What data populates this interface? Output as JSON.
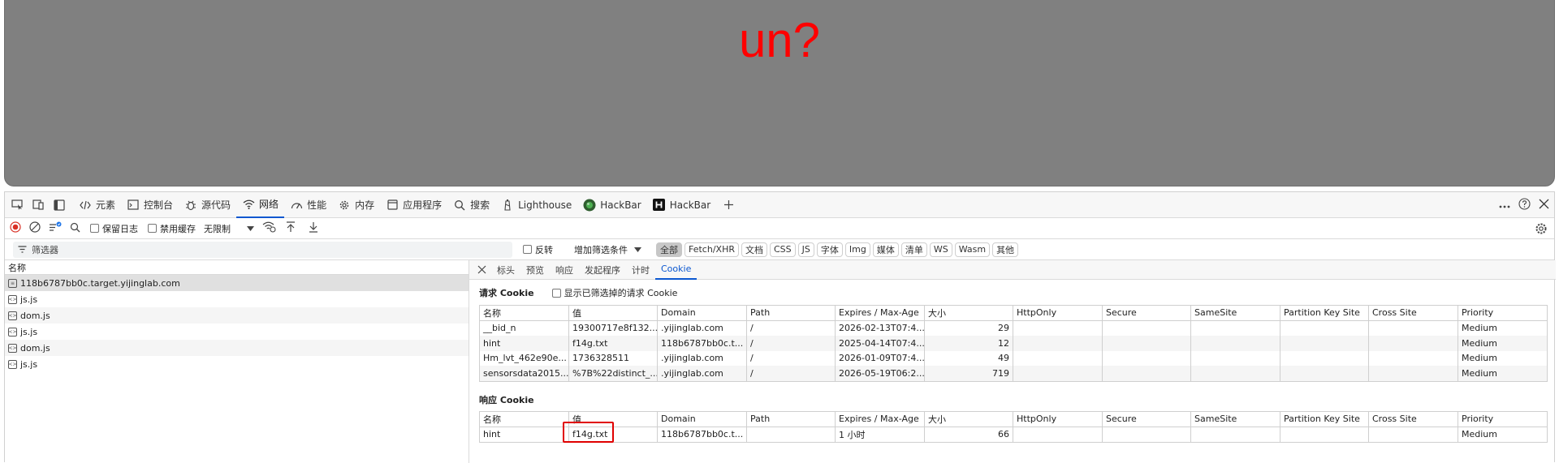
{
  "page": {
    "text": "un?"
  },
  "devtools": {
    "tabs": [
      {
        "label": "元素"
      },
      {
        "label": "控制台"
      },
      {
        "label": "源代码"
      },
      {
        "label": "网络"
      },
      {
        "label": "性能"
      },
      {
        "label": "内存"
      },
      {
        "label": "应用程序"
      },
      {
        "label": "搜索"
      },
      {
        "label": "Lighthouse"
      },
      {
        "label": "HackBar"
      },
      {
        "label": "HackBar"
      }
    ],
    "toolbar": {
      "preserve_log": "保留日志",
      "disable_cache": "禁用缓存",
      "throttling": "无限制"
    },
    "filter": {
      "placeholder": "筛选器",
      "invert": "反转",
      "more_filters": "增加筛选条件"
    },
    "types": [
      "全部",
      "Fetch/XHR",
      "文档",
      "CSS",
      "JS",
      "字体",
      "Img",
      "媒体",
      "清单",
      "WS",
      "Wasm",
      "其他"
    ],
    "requests": {
      "header": "名称",
      "items": [
        "118b6787bb0c.target.yijinglab.com",
        "js.js",
        "dom.js",
        "js.js",
        "dom.js",
        "js.js"
      ]
    },
    "detail_tabs": [
      "标头",
      "预览",
      "响应",
      "发起程序",
      "计时",
      "Cookie"
    ],
    "request_cookies": {
      "title": "请求 Cookie",
      "show_filtered": "显示已筛选掉的请求 Cookie",
      "columns": [
        "名称",
        "值",
        "Domain",
        "Path",
        "Expires / Max-Age",
        "大小",
        "HttpOnly",
        "Secure",
        "SameSite",
        "Partition Key Site",
        "Cross Site",
        "Priority"
      ],
      "rows": [
        [
          "__bid_n",
          "19300717e8f132...",
          ".yijinglab.com",
          "/",
          "2026-02-13T07:4...",
          "29",
          "",
          "",
          "",
          "",
          "",
          "Medium"
        ],
        [
          "hint",
          "f14g.txt",
          "118b6787bb0c.t...",
          "/",
          "2025-04-14T07:4...",
          "12",
          "",
          "",
          "",
          "",
          "",
          "Medium"
        ],
        [
          "Hm_lvt_462e90e...",
          "1736328511",
          ".yijinglab.com",
          "/",
          "2026-01-09T07:4...",
          "49",
          "",
          "",
          "",
          "",
          "",
          "Medium"
        ],
        [
          "sensorsdata2015...",
          "%7B%22distinct_...",
          ".yijinglab.com",
          "/",
          "2026-05-19T06:2...",
          "719",
          "",
          "",
          "",
          "",
          "",
          "Medium"
        ]
      ]
    },
    "response_cookies": {
      "title": "响应 Cookie",
      "columns": [
        "名称",
        "值",
        "Domain",
        "Path",
        "Expires / Max-Age",
        "大小",
        "HttpOnly",
        "Secure",
        "SameSite",
        "Partition Key Site",
        "Cross Site",
        "Priority"
      ],
      "rows": [
        [
          "hint",
          "f14g.txt",
          "118b6787bb0c.t...",
          "",
          "1 小时",
          "66",
          "",
          "",
          "",
          "",
          "",
          "Medium"
        ]
      ]
    }
  },
  "colors": {
    "accent": "#0b57d0",
    "record": "#d93025",
    "highlight": "#e00000",
    "page_text": "#ff0000",
    "page_bg": "#808080"
  }
}
